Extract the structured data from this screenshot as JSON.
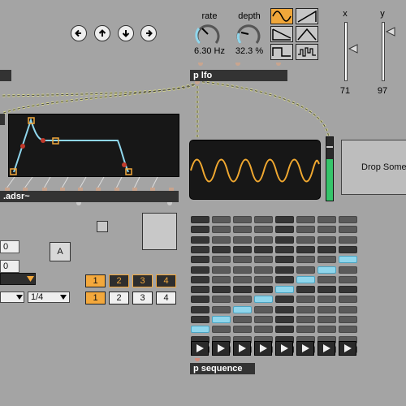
{
  "lfo": {
    "rate_label": "rate",
    "rate_value": "6.30 Hz",
    "depth_label": "depth",
    "depth_value": "32.3 %",
    "object_label": "p lfo"
  },
  "xy": {
    "x_label": "x",
    "x_value": "71",
    "y_label": "y",
    "y_value": "97"
  },
  "adsr": {
    "object_label": ".adsr~"
  },
  "drop_zone": {
    "label": "Drop Somet"
  },
  "left_panel": {
    "num1": "0",
    "num2": "0",
    "button_a": "A",
    "division": "1/4"
  },
  "selector_top": [
    "1",
    "2",
    "3",
    "4"
  ],
  "selector_bottom": [
    "1",
    "2",
    "3",
    "4"
  ],
  "sequence": {
    "object_label": "p sequence"
  },
  "nav": {
    "left": "arrow-left",
    "up": "arrow-up",
    "down": "arrow-down",
    "right": "arrow-right"
  },
  "colors": {
    "accent": "#f3a83c",
    "cell_on": "#8fd6ec",
    "meter": "#35c46a",
    "wave": "#f0a830",
    "envelope": "#8fd6ec"
  }
}
